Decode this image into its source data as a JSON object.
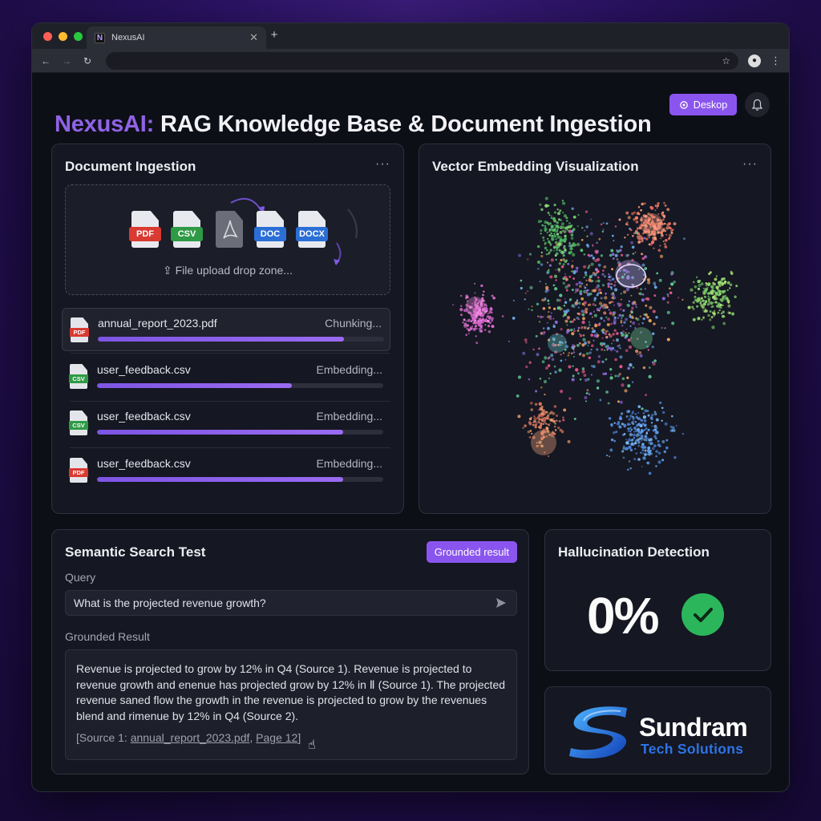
{
  "browser": {
    "tab_title": "NexusAI",
    "tab_favicon_letter": "N",
    "url": ""
  },
  "header": {
    "brand": "NexusAI:",
    "title": "RAG Knowledge Base & Document Ingestion",
    "desktop_button": "Deskop"
  },
  "ingestion": {
    "title": "Document Ingestion",
    "drop_icons": [
      {
        "label": "PDF",
        "color": "#d93a32"
      },
      {
        "label": "CSV",
        "color": "#2f9a46"
      },
      {
        "label": "",
        "color": "#6b6d78"
      },
      {
        "label": "DOC",
        "color": "#2b6fd6"
      },
      {
        "label": "DOCX",
        "color": "#2b6fd6"
      }
    ],
    "drop_label": "File upload drop zone...",
    "files": [
      {
        "icon": "PDF",
        "icon_color": "#d93a32",
        "name": "annual_report_2023.pdf",
        "status": "Chunking...",
        "progress": 0.86
      },
      {
        "icon": "CSV",
        "icon_color": "#2f9a46",
        "name": "user_feedback.csv",
        "status": "Embedding...",
        "progress": 0.68
      },
      {
        "icon": "CSV",
        "icon_color": "#2f9a46",
        "name": "user_feedback.csv",
        "status": "Embedding...",
        "progress": 0.86
      },
      {
        "icon": "PDF",
        "icon_color": "#d93a32",
        "name": "user_feedback.csv",
        "status": "Embedding...",
        "progress": 0.86
      }
    ]
  },
  "embedding": {
    "title": "Vector Embedding Visualization"
  },
  "search": {
    "title": "Semantic Search Test",
    "badge": "Grounded result",
    "query_label": "Query",
    "query_value": "What is the projected revenue growth?",
    "result_label": "Grounded Result",
    "result_text": "Revenue is projected to grow by 12% in Q4 (Source 1). Revenue is projected to revenue growth and enenue has projected grow by 12% in Ⅱ (Source 1). The projected revenue saned flow the growth in the revenue is projected to grow by the revenues blend and rimenue by 12% in Q4 (Source 2).",
    "source_prefix": "[Source 1: ",
    "source_file": "annual_report_2023.pdf",
    "source_sep": ", ",
    "source_page": "Page 12",
    "source_suffix": "]"
  },
  "hallucination": {
    "title": "Hallucination Detection",
    "value": "0%"
  },
  "logo": {
    "word1": "Sundram",
    "word2": "Tech Solutions"
  },
  "colors": {
    "accent": "#8a55ee",
    "success": "#2cb65b",
    "logo_blue": "#2d74e6"
  }
}
